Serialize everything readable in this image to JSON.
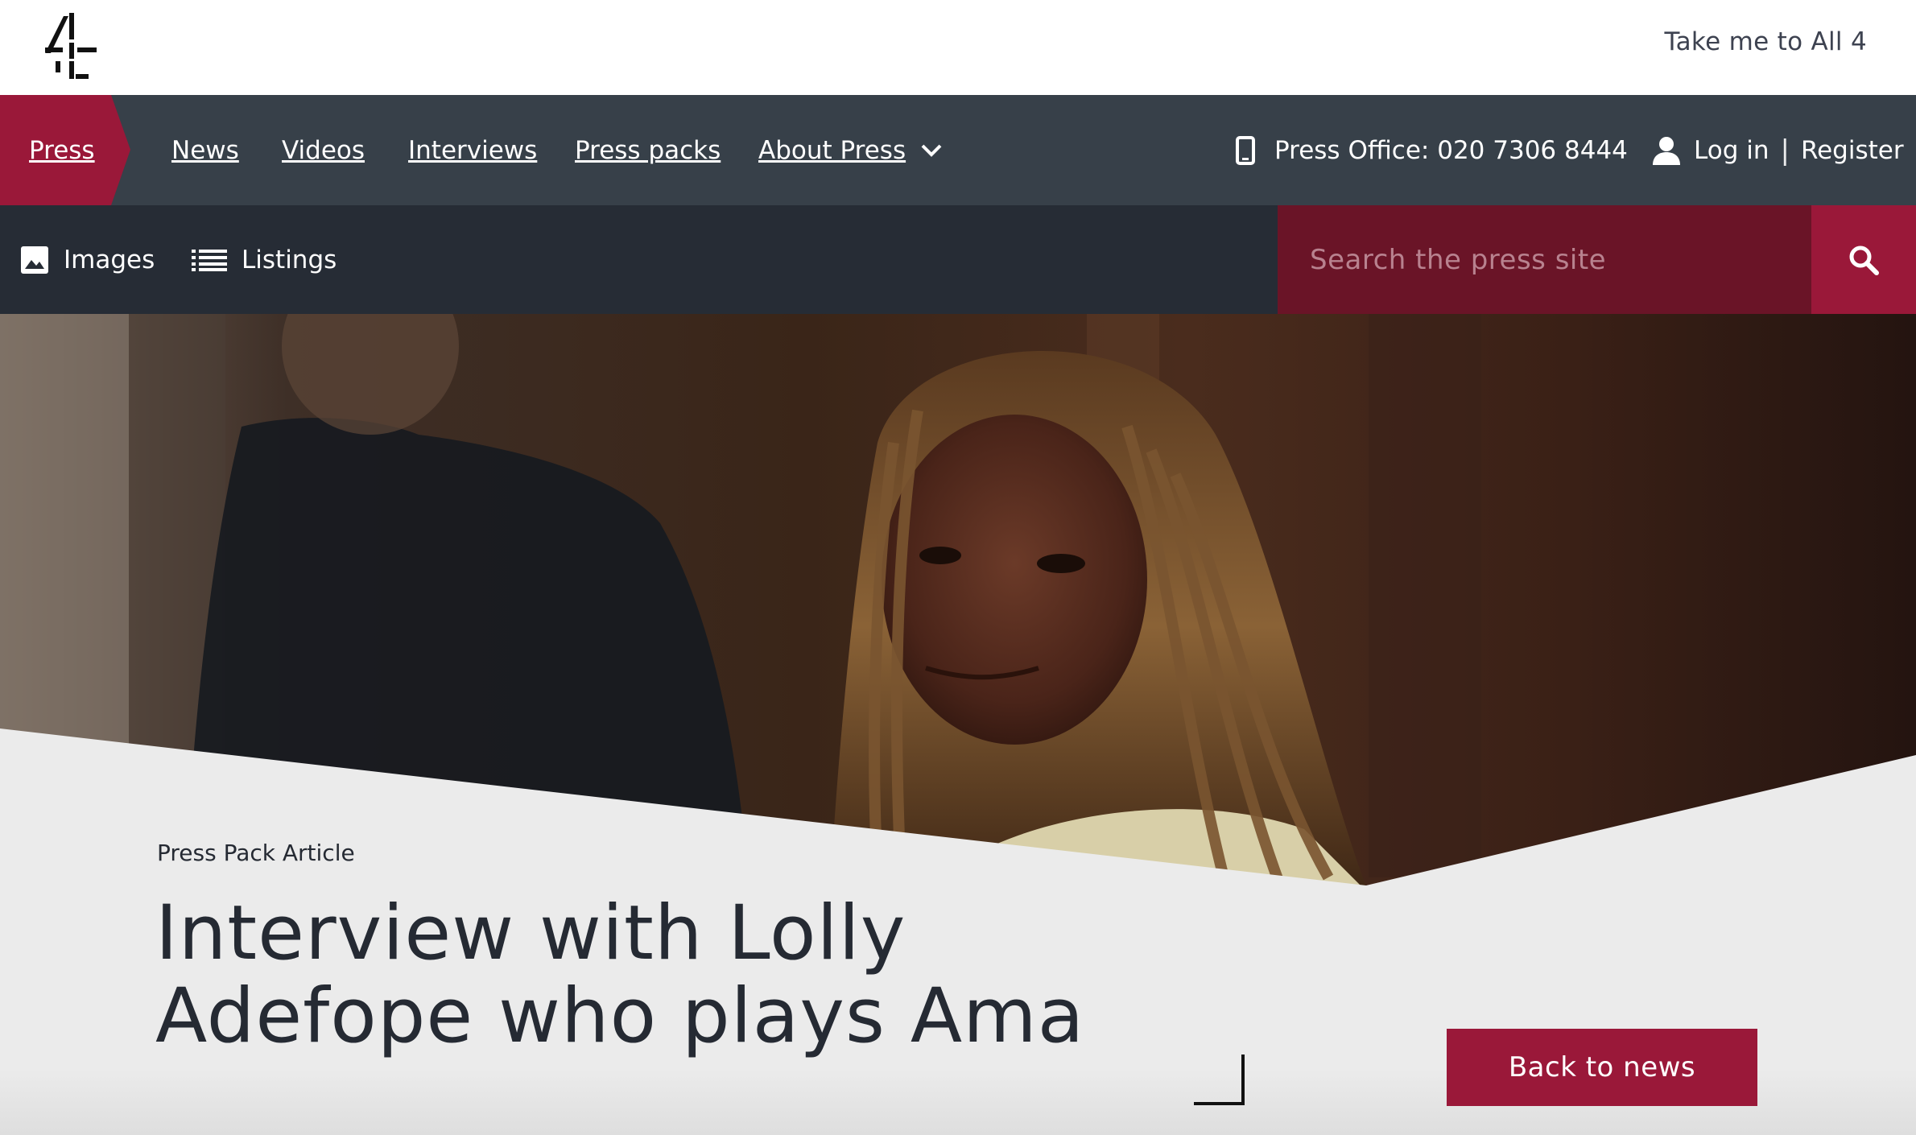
{
  "colors": {
    "brand": "#9a1839",
    "nav_primary": "#374049",
    "nav_secondary": "#262c35",
    "search_bg": "#6a1427",
    "text_dark": "#252a33"
  },
  "header": {
    "logo_icon": "channel-4-logo",
    "all4_link": "Take me to All 4"
  },
  "primary_nav": {
    "press_tab": "Press",
    "items": [
      {
        "label": "News"
      },
      {
        "label": "Videos"
      },
      {
        "label": "Interviews"
      },
      {
        "label": "Press packs"
      },
      {
        "label": "About Press",
        "icon": "chevron-down-icon"
      }
    ],
    "press_office": "Press Office: 020 7306 8444",
    "press_office_icon": "phone-icon",
    "login": "Log in",
    "separator": "|",
    "register": "Register",
    "account_icon": "user-icon"
  },
  "secondary_nav": {
    "images": "Images",
    "images_icon": "image-icon",
    "listings": "Listings",
    "listings_icon": "list-icon",
    "search_placeholder": "Search the press site",
    "search_icon": "search-icon"
  },
  "article": {
    "kicker": "Press Pack Article",
    "title": "Interview with Lolly Adefope who plays Ama",
    "back_button": "Back to news"
  }
}
